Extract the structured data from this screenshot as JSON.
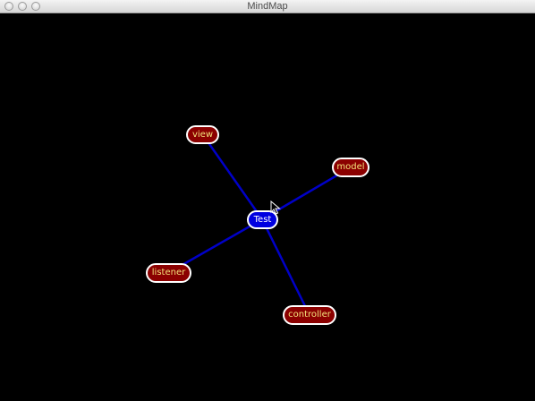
{
  "window": {
    "title": "MindMap"
  },
  "colors": {
    "background": "#000000",
    "edge": "#0000c8",
    "root_fill": "#0000e0",
    "child_fill": "#8b0000",
    "child_text": "#f2e07a",
    "node_border": "#ffffff"
  },
  "mindmap": {
    "root": {
      "label": "Test"
    },
    "children": [
      {
        "label": "view"
      },
      {
        "label": "model"
      },
      {
        "label": "listener"
      },
      {
        "label": "controller"
      }
    ]
  }
}
